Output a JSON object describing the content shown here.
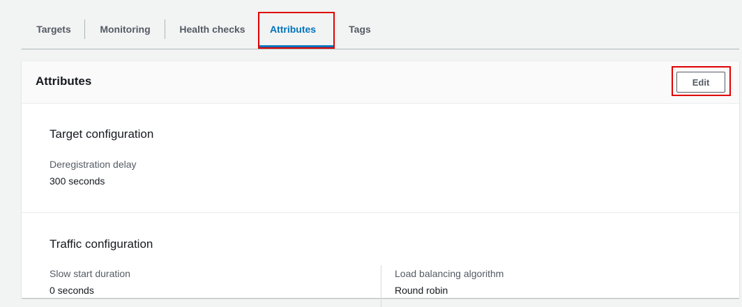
{
  "tabs": [
    {
      "label": "Targets"
    },
    {
      "label": "Monitoring"
    },
    {
      "label": "Health checks"
    },
    {
      "label": "Attributes",
      "active": true
    },
    {
      "label": "Tags"
    }
  ],
  "panel": {
    "title": "Attributes",
    "edit_label": "Edit"
  },
  "target_configuration": {
    "title": "Target configuration",
    "deregistration_delay_label": "Deregistration delay",
    "deregistration_delay_value": "300 seconds"
  },
  "traffic_configuration": {
    "title": "Traffic configuration",
    "slow_start_label": "Slow start duration",
    "slow_start_value": "0 seconds",
    "algorithm_label": "Load balancing algorithm",
    "algorithm_value": "Round robin"
  },
  "colors": {
    "accent": "#0073bb",
    "highlight": "#e00000",
    "text": "#16191f",
    "muted": "#545b64"
  }
}
